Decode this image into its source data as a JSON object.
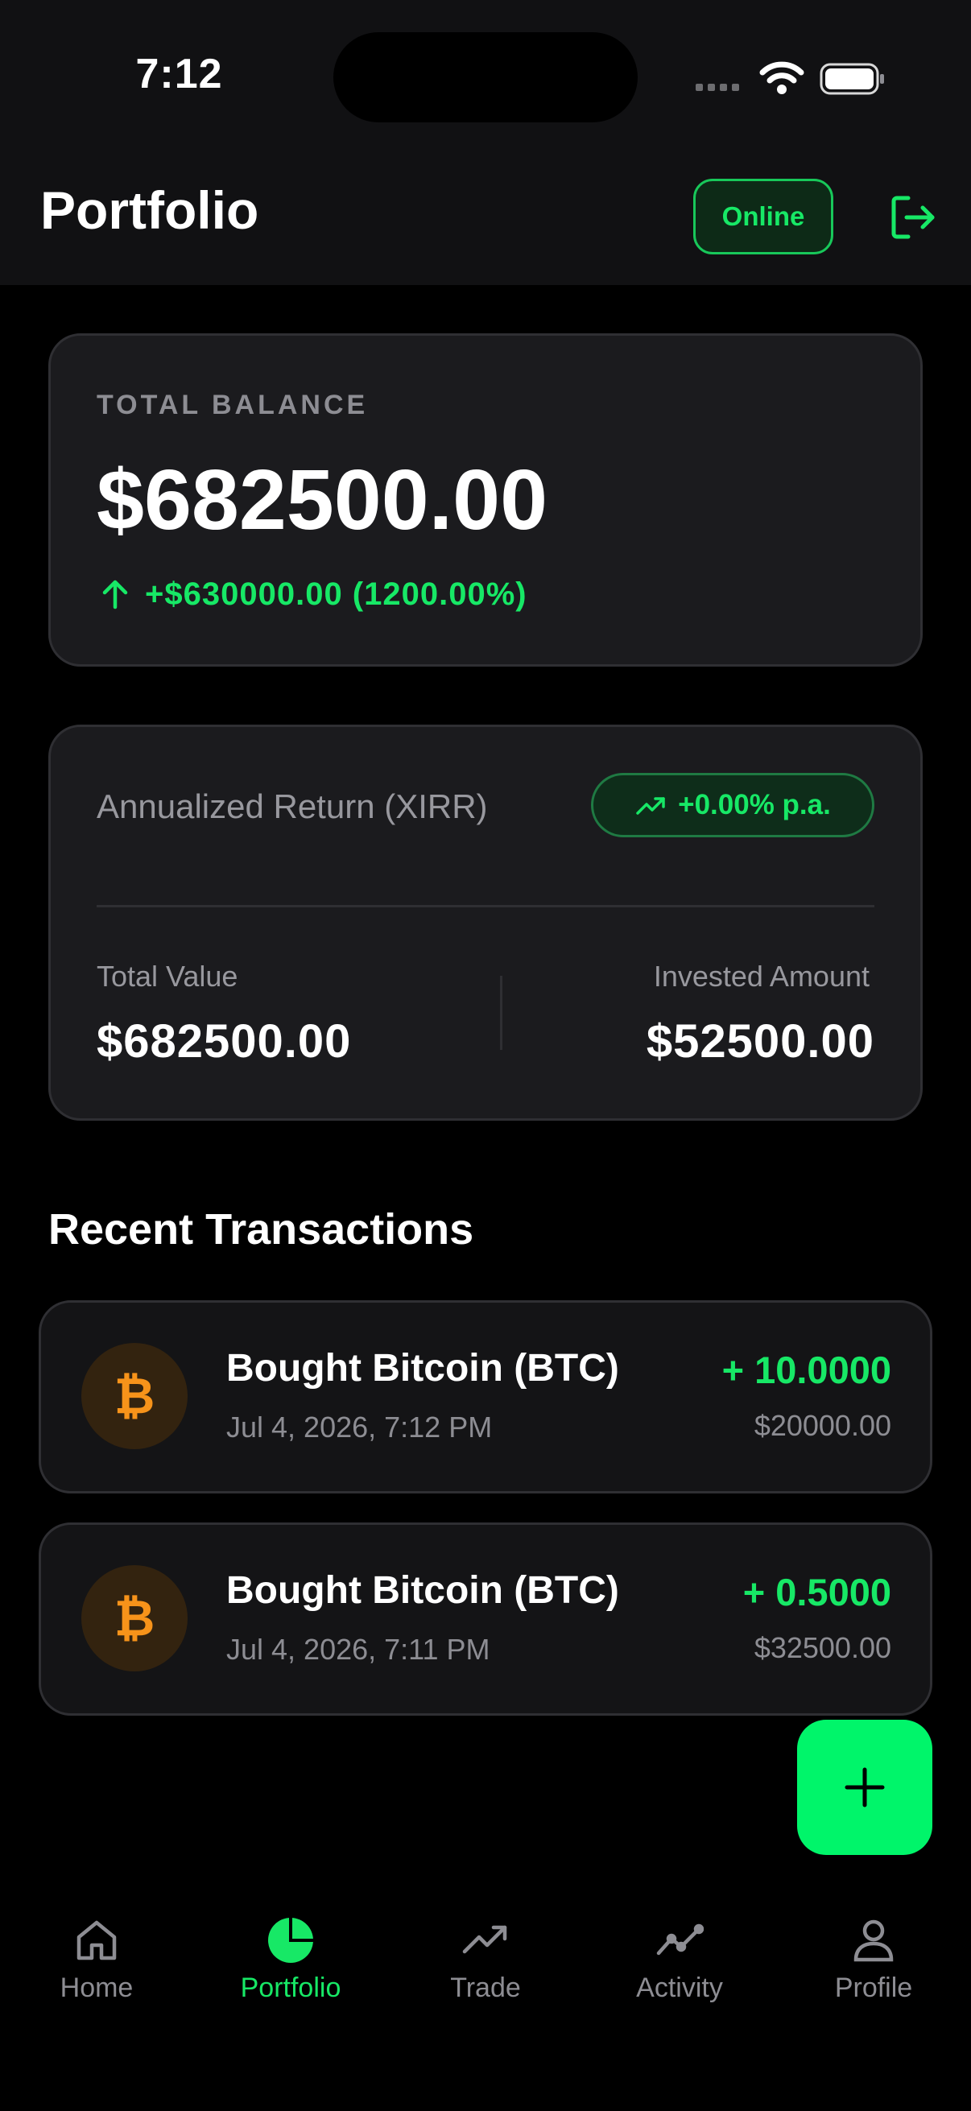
{
  "status_bar": {
    "time": "7:12"
  },
  "header": {
    "title": "Portfolio",
    "status_badge": "Online"
  },
  "balance": {
    "label": "TOTAL BALANCE",
    "value": "$682500.00",
    "change": "+$630000.00 (1200.00%)"
  },
  "summary": {
    "xirr_label": "Annualized Return (XIRR)",
    "xirr_badge": "+0.00% p.a.",
    "total_value_label": "Total Value",
    "total_value": "$682500.00",
    "invested_label": "Invested Amount",
    "invested_value": "$52500.00"
  },
  "transactions": {
    "title": "Recent Transactions",
    "items": [
      {
        "symbol": "₿",
        "title": "Bought Bitcoin (BTC)",
        "date": "Jul 4, 2026, 7:12 PM",
        "quantity": "+ 10.0000",
        "amount": "$20000.00"
      },
      {
        "symbol": "₿",
        "title": "Bought Bitcoin (BTC)",
        "date": "Jul 4, 2026, 7:11 PM",
        "quantity": "+ 0.5000",
        "amount": "$32500.00"
      }
    ]
  },
  "nav": {
    "items": [
      {
        "label": "Home",
        "icon": "home-icon"
      },
      {
        "label": "Portfolio",
        "icon": "pie-chart-icon",
        "active": true
      },
      {
        "label": "Trade",
        "icon": "trending-up-icon"
      },
      {
        "label": "Activity",
        "icon": "activity-icon"
      },
      {
        "label": "Profile",
        "icon": "user-icon"
      }
    ]
  },
  "colors": {
    "accent": "#17e866",
    "background": "#000000",
    "card": "#1b1b1e",
    "bitcoin": "#f7931a"
  }
}
